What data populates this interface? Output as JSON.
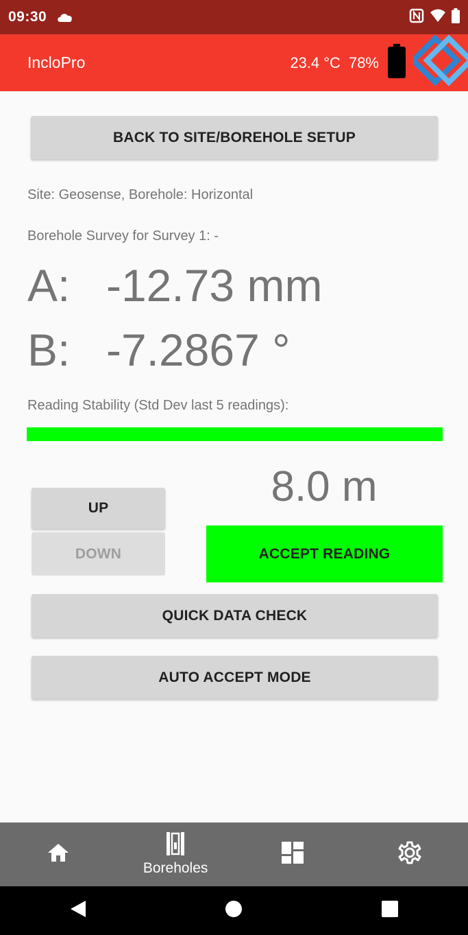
{
  "status_bar": {
    "time": "09:30",
    "icons": [
      "cloud-icon",
      "nfc-icon",
      "wifi-icon",
      "battery-icon"
    ]
  },
  "app_bar": {
    "title": "IncloPro",
    "temperature": "23.4 °C",
    "humidity": "78%",
    "icons": [
      "probe-battery-icon",
      "geosense-logo-icon"
    ],
    "colors": {
      "app_bar": "#f2392c",
      "status_bar": "#94231b"
    }
  },
  "main": {
    "back_button_label": "BACK TO SITE/BOREHOLE SETUP",
    "site_info": "Site: Geosense, Borehole: Horizontal",
    "survey_info": "Borehole Survey for Survey 1: -",
    "reading_a": {
      "label": "A:",
      "value": "-12.73 mm"
    },
    "reading_b": {
      "label": "B:",
      "value": "-7.2867 °"
    },
    "stability_label": "Reading Stability (Std Dev last 5 readings):",
    "stability_level": 1.0,
    "stability_color": "#00ff00",
    "depth": "8.0 m",
    "up_label": "UP",
    "down_label": "DOWN",
    "accept_label": "ACCEPT READING",
    "quick_check_label": "QUICK DATA CHECK",
    "auto_accept_label": "AUTO ACCEPT MODE"
  },
  "bottom_nav": {
    "items": [
      {
        "icon": "home-icon",
        "label": ""
      },
      {
        "icon": "boreholes-icon",
        "label": "Boreholes"
      },
      {
        "icon": "dashboard-icon",
        "label": ""
      },
      {
        "icon": "gear-icon",
        "label": ""
      }
    ]
  },
  "system_nav": {
    "icons": [
      "back-icon",
      "home-circle-icon",
      "recents-icon"
    ]
  }
}
